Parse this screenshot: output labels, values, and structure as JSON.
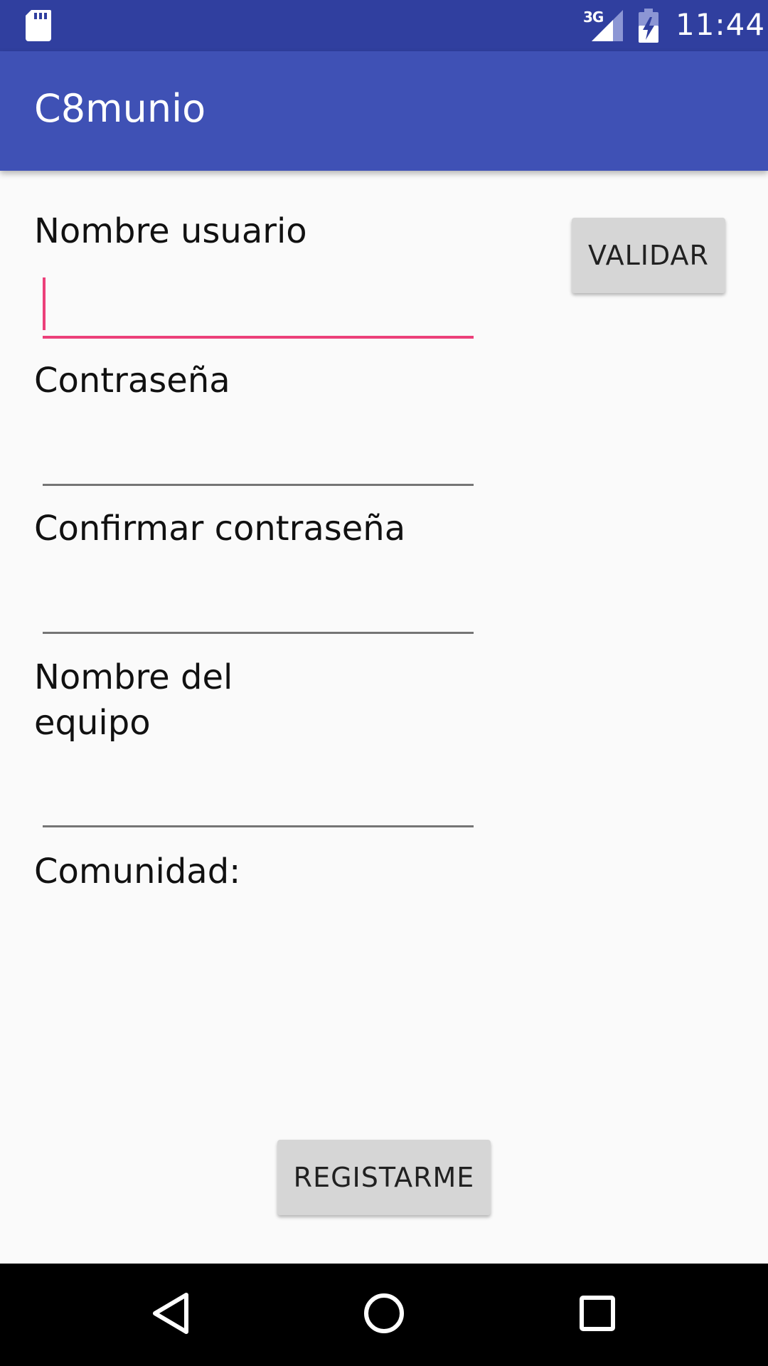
{
  "status_bar": {
    "network": "3G",
    "time": "11:44",
    "icons": [
      "sd-card-icon",
      "signal-icon",
      "battery-charging-icon"
    ]
  },
  "app_bar": {
    "title": "C8munio"
  },
  "form": {
    "username_label": "Nombre usuario",
    "username_value": "",
    "validate_button": "VALIDAR",
    "password_label": "Contraseña",
    "password_value": "",
    "confirm_label": "Confirmar contraseña",
    "confirm_value": "",
    "team_label": "Nombre del equipo",
    "team_value": "",
    "community_label": "Comunidad:"
  },
  "register_button": "REGISTARME",
  "navigation": {
    "icons": [
      "back-icon",
      "home-icon",
      "recent-apps-icon"
    ]
  },
  "colors": {
    "status_bar": "#303f9f",
    "app_bar": "#3f51b5",
    "accent": "#ec407a",
    "button": "#d6d6d6"
  }
}
